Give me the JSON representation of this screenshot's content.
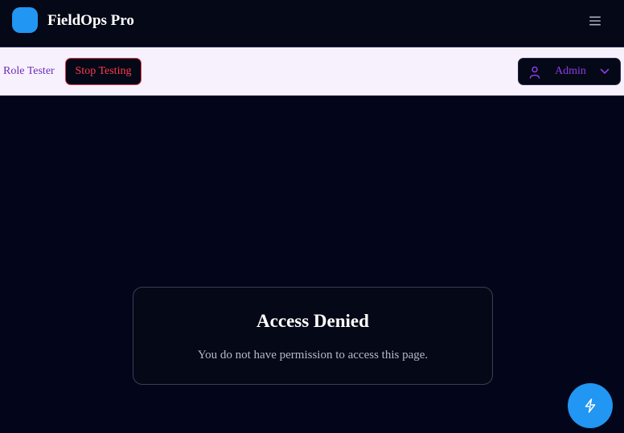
{
  "app": {
    "title": "FieldOps Pro",
    "logo_color": "#2196f3"
  },
  "header": {
    "menu_icon": "hamburger-menu-icon"
  },
  "role_tester": {
    "label": "Role Tester",
    "stop_label": "Stop Testing",
    "selected_role": "Admin",
    "role_icon": "user-icon",
    "dropdown_icon": "chevron-down-icon"
  },
  "access": {
    "title": "Access Denied",
    "message": "You do not have permission to access this page."
  },
  "fab": {
    "icon": "lightning-icon",
    "color": "#2196f3"
  },
  "colors": {
    "background": "#03061a",
    "accent": "#2196f3",
    "danger": "#ff3b4e",
    "role_purple": "#8b3ce6"
  }
}
